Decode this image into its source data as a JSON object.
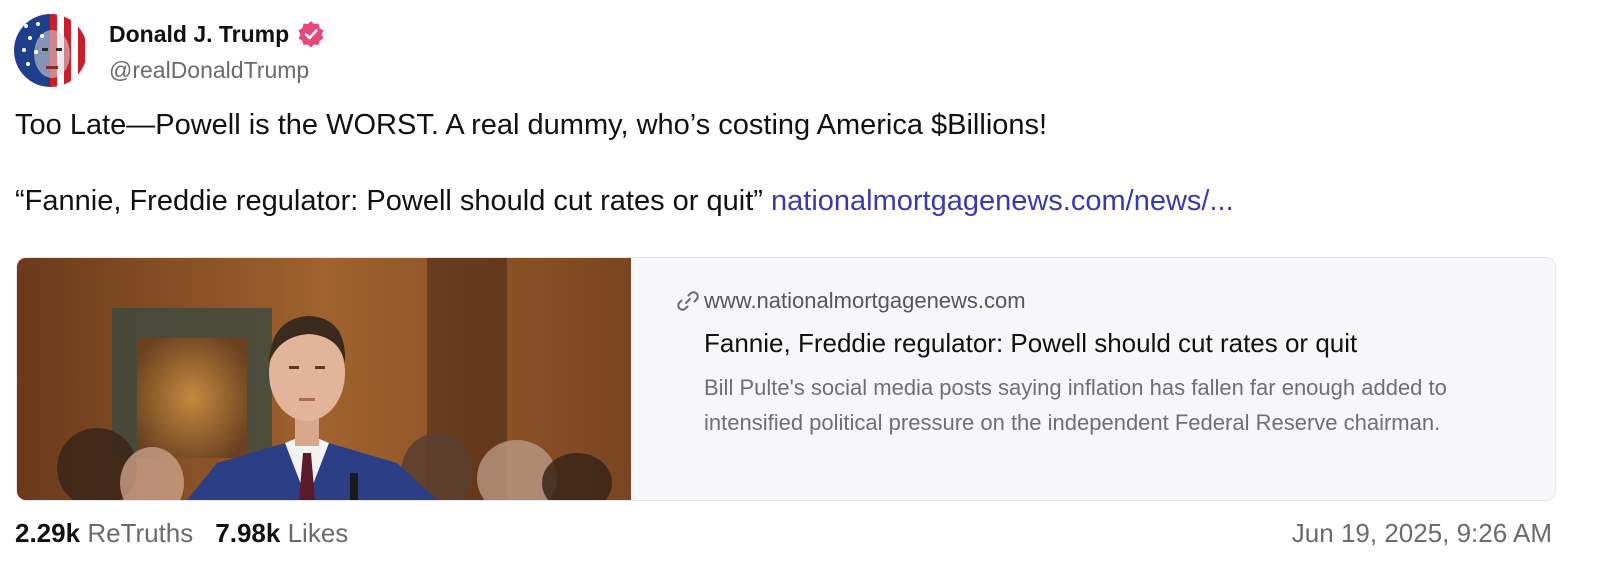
{
  "author": {
    "display_name": "Donald J. Trump",
    "handle": "@realDonaldTrump",
    "verified_icon": "verified-badge-icon",
    "verified_color": "#e8477e"
  },
  "post": {
    "text_line1": "Too Late—Powell is the WORST. A real dummy, who’s costing America $Billions!",
    "quote": "“Fannie, Freddie regulator: Powell should cut rates or quit”",
    "link_text": "nationalmortgagenews.com/news/...",
    "link_color": "#3a3ab0"
  },
  "link_card": {
    "domain": "www.nationalmortgagenews.com",
    "title": "Fannie, Freddie regulator: Powell should cut rates or quit",
    "description": "Bill Pulte's social media posts saying inflation has fallen far enough added to intensified political pressure on the independent Federal Reserve chairman.",
    "icon": "link-icon"
  },
  "stats": {
    "retruths_count": "2.29k",
    "retruths_label": "ReTruths",
    "likes_count": "7.98k",
    "likes_label": "Likes"
  },
  "timestamp": "Jun 19, 2025, 9:26 AM"
}
